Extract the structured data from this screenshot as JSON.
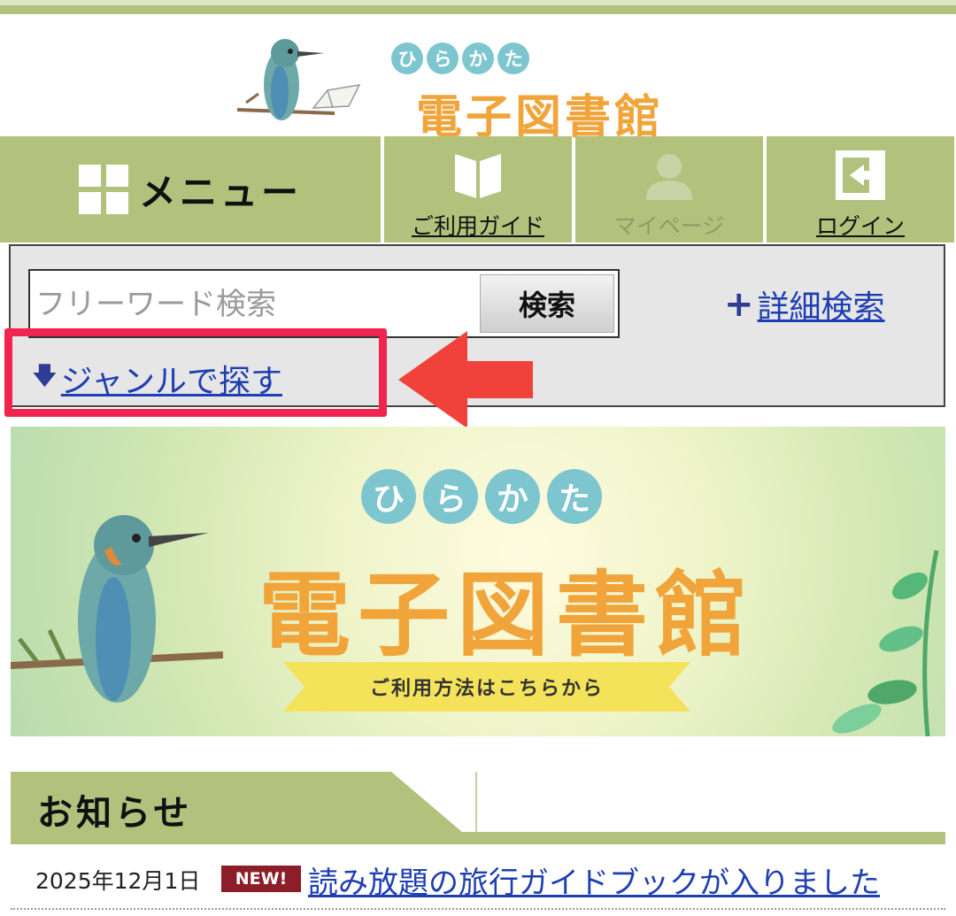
{
  "header": {
    "logo_hiragana": [
      "ひ",
      "ら",
      "か",
      "た"
    ],
    "logo_title": "電子図書館"
  },
  "nav": {
    "menu_label": "メニュー",
    "guide_label": "ご利用ガイド",
    "mypage_label": "マイページ",
    "login_label": "ログイン"
  },
  "search": {
    "placeholder": "フリーワード検索",
    "button_label": "検索",
    "advanced_label": "詳細検索",
    "genre_label": "ジャンルで探す"
  },
  "banner": {
    "hiragana": [
      "ひ",
      "ら",
      "か",
      "た"
    ],
    "title": "電子図書館",
    "ribbon_text": "ご利用方法はこちらから"
  },
  "news": {
    "heading": "お知らせ",
    "items": [
      {
        "date": "2025年12月1日",
        "badge": "NEW!",
        "title": "読み放題の旅行ガイドブックが入りました"
      }
    ]
  },
  "colors": {
    "nav_green": "#b2c27c",
    "logo_orange": "#f0a43a",
    "hira_teal": "#7ec6cf",
    "highlight_red": "#f0244e",
    "link_blue": "#1e3fb3",
    "badge_red": "#8e1d2a"
  }
}
